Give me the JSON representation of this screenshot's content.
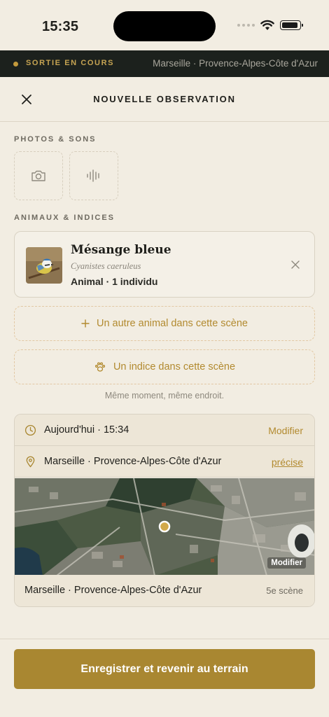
{
  "status_bar": {
    "time": "15:35"
  },
  "outing": {
    "status": "SORTIE EN COURS",
    "location": "Marseille · Provence-Alpes-Côte d'Azur",
    "accent_color": "#C39A3C"
  },
  "header": {
    "title": "NOUVELLE OBSERVATION",
    "close_icon": "close-icon"
  },
  "media": {
    "section_label": "PHOTOS & SONS",
    "tiles": [
      {
        "icon": "camera-icon"
      },
      {
        "icon": "audio-wave-icon"
      }
    ]
  },
  "animals": {
    "section_label": "ANIMAUX & INDICES",
    "species": {
      "name": "Mésange bleue",
      "latin_name": "Cyanistes caeruleus",
      "meta": "Animal · 1 individu"
    },
    "add_animal_label": "Un autre animal dans cette scène",
    "add_clue_label": "Un indice dans cette scène",
    "helper": "Même moment, même endroit."
  },
  "context": {
    "date_text": "Aujourd'hui · 15:34",
    "date_action": "Modifier",
    "place_text": "Marseille · Provence-Alpes-Côte d'Azur",
    "place_action": "précise",
    "map_action": "Modifier",
    "footer_place": "Marseille · Provence-Alpes-Côte d'Azur",
    "footer_scene": "5e scène"
  },
  "save_button": {
    "label": "Enregistrer et revenir au terrain",
    "color": "#A98731"
  }
}
